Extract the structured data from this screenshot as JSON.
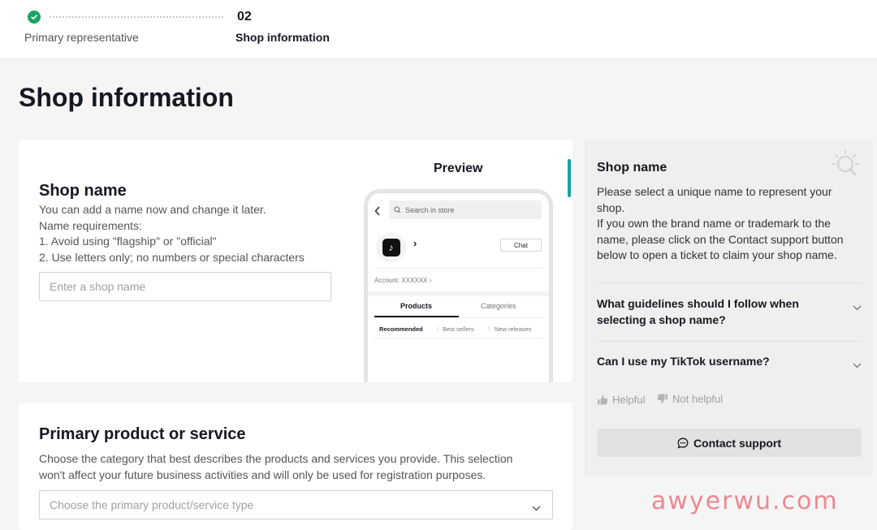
{
  "stepper": {
    "step1_label": "Primary representative",
    "step2_number": "02",
    "step2_label": "Shop information"
  },
  "page_title": "Shop information",
  "shop_name_section": {
    "title": "Shop name",
    "desc_lines": [
      "You can add a name now and change it later.",
      "Name requirements:",
      "1. Avoid using \"flagship\" or \"official\"",
      "2. Use letters only; no numbers or special characters"
    ],
    "input_placeholder": "Enter a shop name"
  },
  "preview": {
    "label": "Preview",
    "search_placeholder": "Search in store",
    "chat_label": "Chat",
    "account_text": "Account: XXXXXX",
    "tabs": [
      "Products",
      "Categories"
    ],
    "subtabs": [
      "Recommended",
      "Best sellers",
      "New releases"
    ]
  },
  "primary_product_section": {
    "title": "Primary product or service",
    "desc_lines": [
      "Choose the category that best describes the products and services you provide. This selection",
      "won't affect your future business activities and will only be used for registration purposes."
    ],
    "select_placeholder": "Choose the primary product/service type"
  },
  "help_panel": {
    "title": "Shop name",
    "desc_lines": [
      "Please select a unique name to represent your",
      "shop.",
      "If you own the brand name or trademark to the",
      "name, please click on the Contact support button",
      "below to open a ticket to claim your shop name."
    ],
    "faqs": [
      [
        "What guidelines should I follow when",
        "selecting a shop name?"
      ],
      [
        "Can I use my TikTok username?"
      ]
    ],
    "helpful_label": "Helpful",
    "not_helpful_label": "Not helpful",
    "contact_label": "Contact support"
  },
  "watermark": "awyerwu.com",
  "colors": {
    "success": "#1aa260",
    "accent": "#1aa3a0",
    "watermark": "#e86e78"
  }
}
